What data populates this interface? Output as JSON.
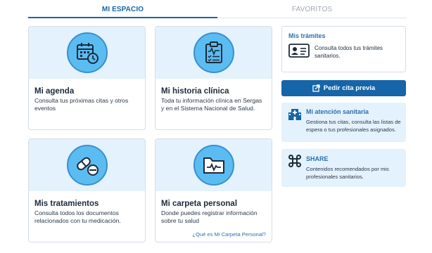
{
  "tabs": {
    "mi_espacio": "MI ESPACIO",
    "favoritos": "FAVORITOS"
  },
  "cards": {
    "agenda": {
      "title": "Mi agenda",
      "desc": "Consulta tus próximas citas y otros eventos",
      "icon": "calendar-clock-icon"
    },
    "historia": {
      "title": "Mi historia clínica",
      "desc": "Toda tu información clínica en Sergas y en el Sistema Nacional de Salud.",
      "icon": "clipboard-icon"
    },
    "tratamientos": {
      "title": "Mis tratamientos",
      "desc": "Consulta todos los documentos relacionados con tu medicación.",
      "icon": "pills-icon"
    },
    "carpeta": {
      "title": "Mi carpeta personal",
      "desc": "Donde puedes registrar información sobre tu salud",
      "link": "¿Qué es Mi Carpeta Personal?",
      "icon": "folder-heartbeat-icon"
    }
  },
  "tramites": {
    "title": "Mis trámites",
    "desc": "Consulta todos tus trámites sanitarios.",
    "icon": "id-card-icon"
  },
  "cita_button": {
    "label": "Pedir cita previa",
    "icon": "external-link-icon"
  },
  "atencion": {
    "title": "Mi atención sanitaria",
    "desc": "Gestiona tus citas, consulta las listas de espera o tus profesionales asignados.",
    "icon": "hospital-icon"
  },
  "share": {
    "title": "SHARE",
    "desc": "Contenidos recomendados por mis profesionales sanitarios.",
    "icon": "command-icon"
  },
  "colors": {
    "primary": "#1565a8",
    "light_bg": "#e3f2fc",
    "icon_circle": "#5bbcf1",
    "link": "#2f6fb0"
  }
}
